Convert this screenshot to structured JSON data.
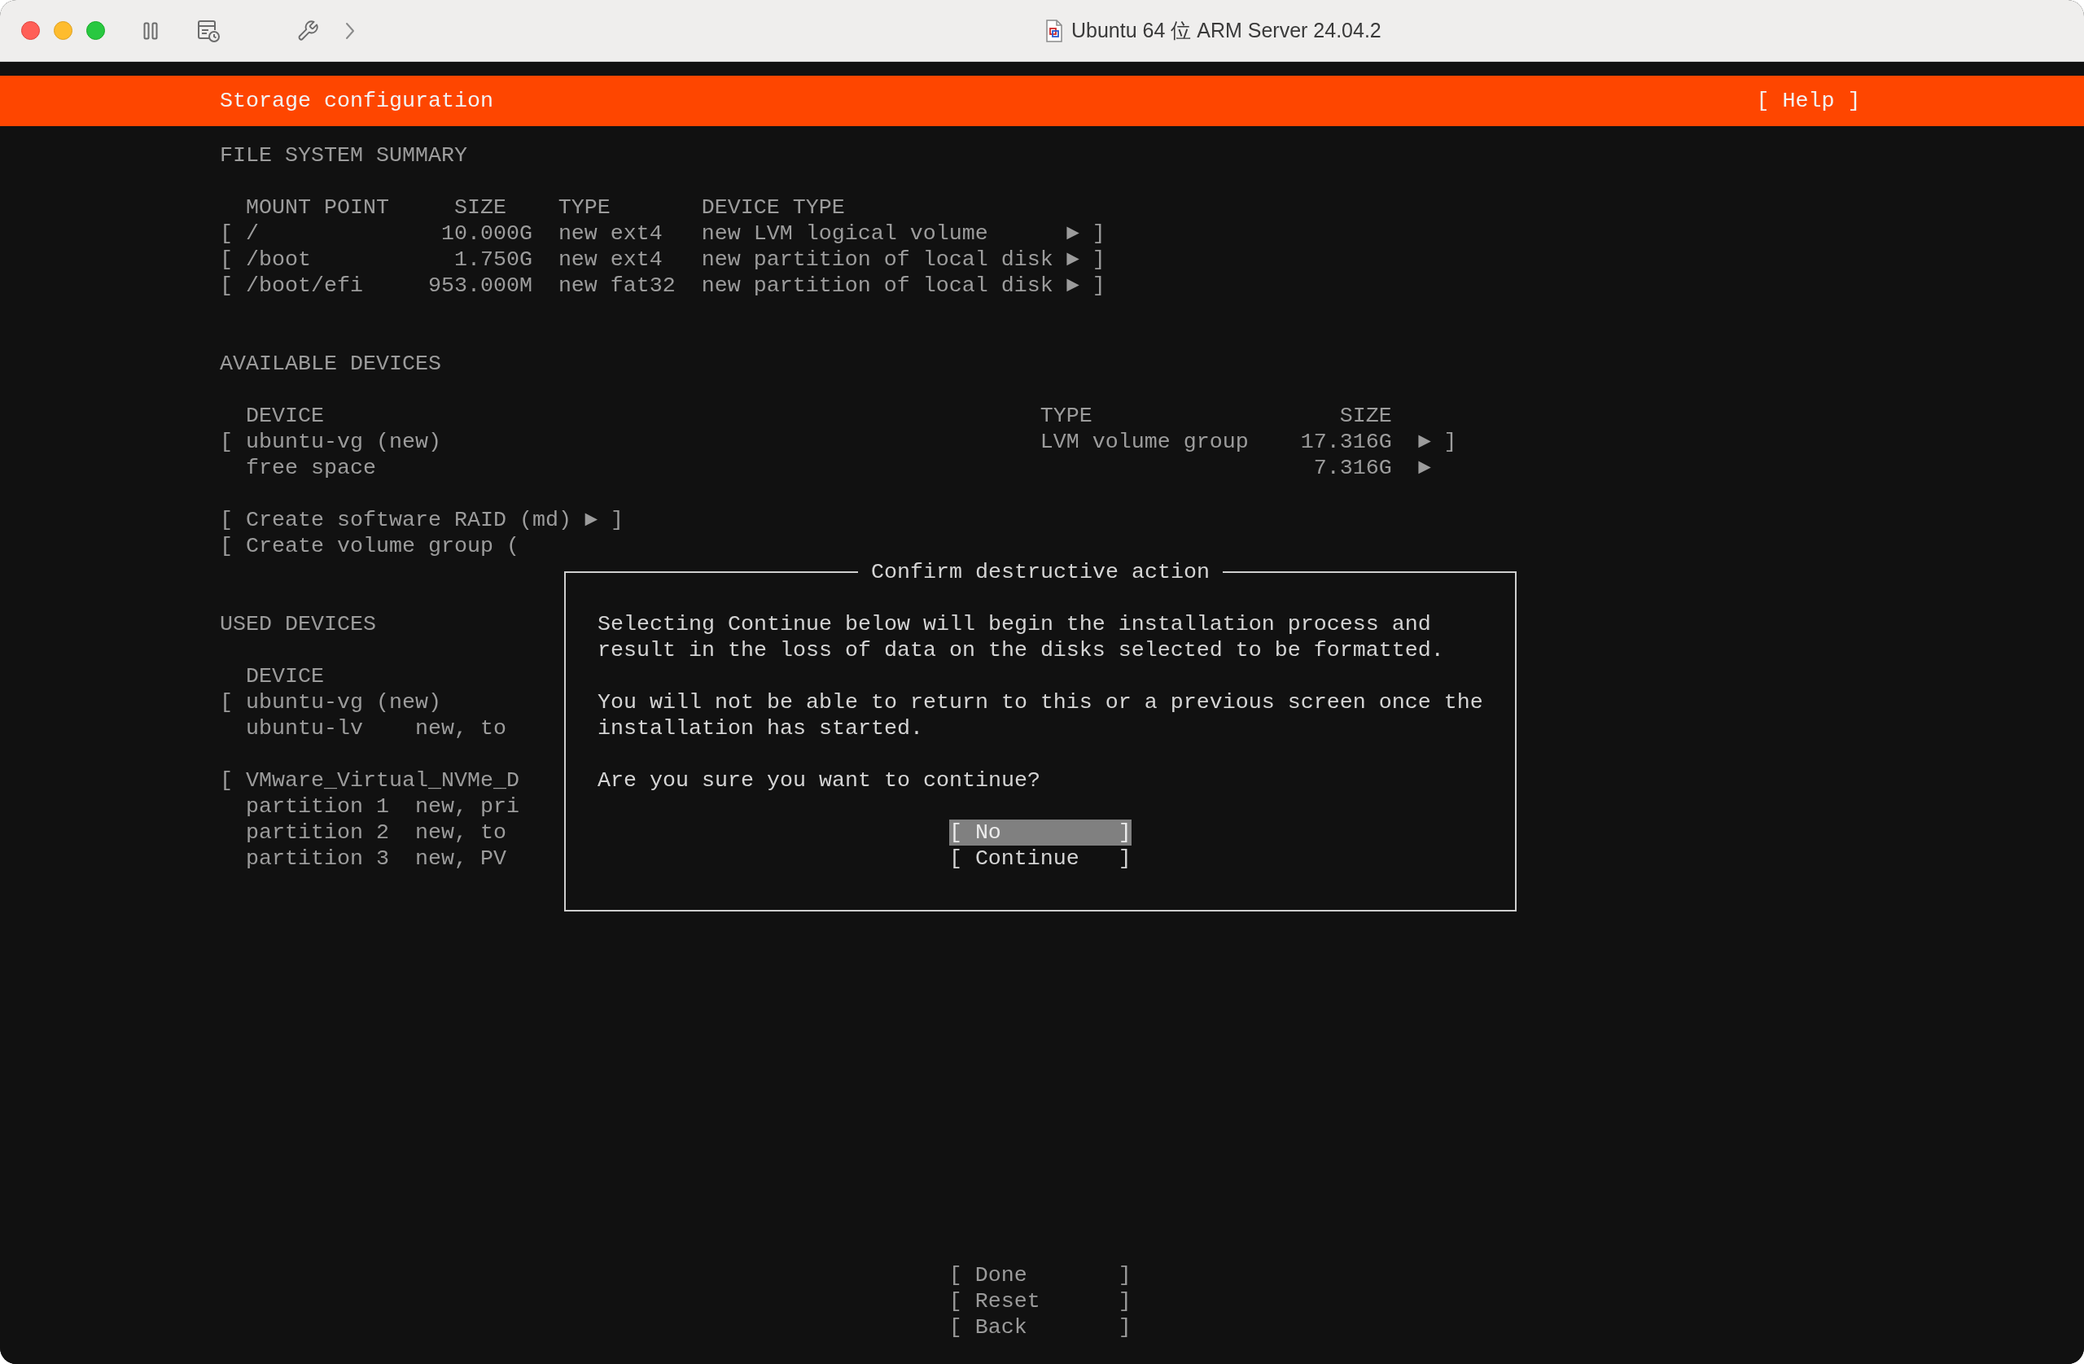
{
  "window": {
    "title": "Ubuntu 64 位 ARM Server 24.04.2"
  },
  "header": {
    "title": "Storage configuration",
    "help": {
      "open": "[",
      "label": "Help",
      "close": "]"
    }
  },
  "file_system_summary": {
    "heading": "FILE SYSTEM SUMMARY",
    "columns": [
      "MOUNT POINT",
      "SIZE",
      "TYPE",
      "DEVICE TYPE"
    ],
    "rows": [
      {
        "open": "[",
        "mount_point": "/",
        "size": "10.000G",
        "type": "new ext4",
        "device_type": "new LVM logical volume",
        "arrow": "►",
        "close": "]"
      },
      {
        "open": "[",
        "mount_point": "/boot",
        "size": "1.750G",
        "type": "new ext4",
        "device_type": "new partition of local disk",
        "arrow": "►",
        "close": "]"
      },
      {
        "open": "[",
        "mount_point": "/boot/efi",
        "size": "953.000M",
        "type": "new fat32",
        "device_type": "new partition of local disk",
        "arrow": "►",
        "close": "]"
      }
    ]
  },
  "available_devices": {
    "heading": "AVAILABLE DEVICES",
    "columns": [
      "DEVICE",
      "TYPE",
      "SIZE"
    ],
    "rows": [
      {
        "open": "[",
        "device": "ubuntu-vg (new)",
        "type": "LVM volume group",
        "size": "17.316G",
        "arrow": "►",
        "close": "]"
      },
      {
        "device": "free space",
        "size": "7.316G",
        "arrow": "►"
      }
    ],
    "actions": [
      {
        "open": "[",
        "label": "Create software RAID (md)",
        "arrow": "►",
        "close": "]"
      },
      {
        "open": "[",
        "label": "Create volume group ("
      }
    ]
  },
  "used_devices": {
    "heading": "USED DEVICES",
    "columns": [
      "DEVICE"
    ],
    "devices": [
      {
        "open": "[",
        "device": "ubuntu-vg (new)",
        "children": [
          {
            "device": "ubuntu-lv",
            "column_2": "new, to"
          }
        ]
      },
      {
        "open": "[",
        "device": "VMware_Virtual_NVMe_D",
        "children": [
          {
            "device": "partition 1",
            "column_2": "new, pri"
          },
          {
            "device": "partition 2",
            "column_2": "new, to"
          },
          {
            "device": "partition 3",
            "column_2": "new, PV"
          }
        ]
      }
    ]
  },
  "dialog": {
    "title": "Confirm destructive action",
    "paragraphs": [
      "Selecting Continue below will begin the installation process and result in the loss of data on the disks selected to be formatted.",
      "You will not be able to return to this or a previous screen once the installation has started.",
      "Are you sure you want to continue?"
    ],
    "buttons": [
      {
        "open": "[",
        "label": "No",
        "close": "]",
        "selected": true
      },
      {
        "open": "[",
        "label": "Continue",
        "close": "]",
        "selected": false
      }
    ]
  },
  "footer_buttons": [
    {
      "open": "[",
      "label": "Done",
      "close": "]"
    },
    {
      "open": "[",
      "label": "Reset",
      "close": "]"
    },
    {
      "open": "[",
      "label": "Back",
      "close": "]"
    }
  ]
}
